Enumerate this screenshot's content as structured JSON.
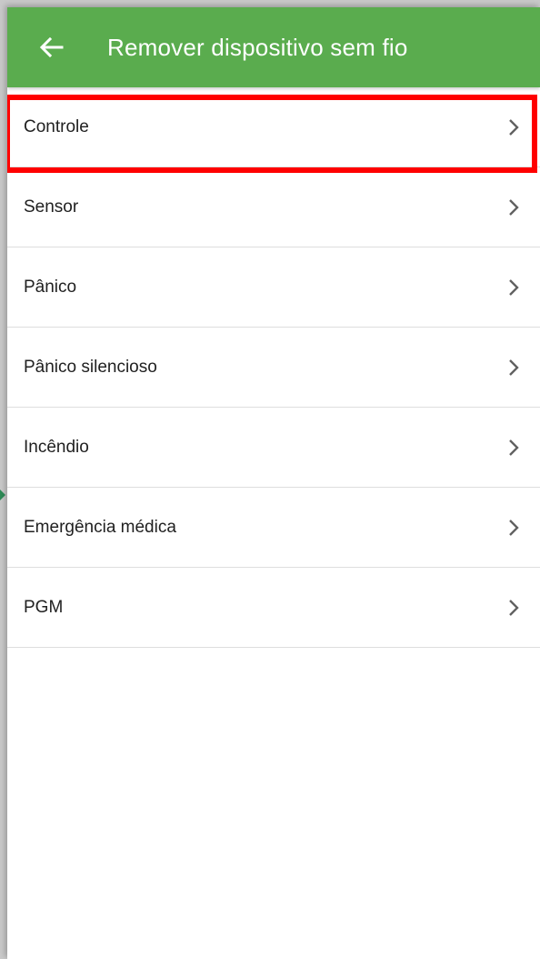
{
  "header": {
    "title": "Remover dispositivo sem fio",
    "back_icon": "arrow-left-icon",
    "background_color": "#5aac4e"
  },
  "list": {
    "items": [
      {
        "label": "Controle"
      },
      {
        "label": "Sensor"
      },
      {
        "label": "Pânico"
      },
      {
        "label": "Pânico silencioso"
      },
      {
        "label": "Incêndio"
      },
      {
        "label": "Emergência médica"
      },
      {
        "label": "PGM"
      }
    ],
    "chevron_icon": "chevron-right-icon"
  },
  "annotation": {
    "highlight_color": "#ff0000",
    "highlighted_item": "Sensor"
  }
}
